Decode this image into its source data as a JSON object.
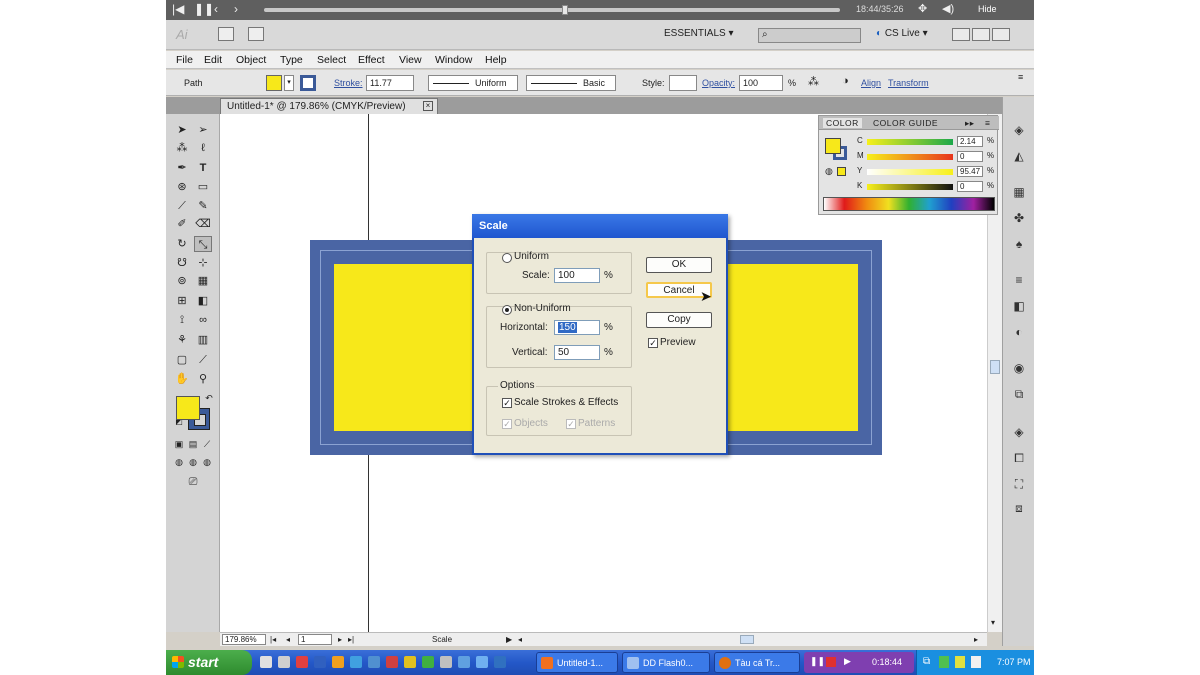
{
  "video_player": {
    "time": "18:44/35:26",
    "hide_label": "Hide"
  },
  "app": {
    "logo": "Ai",
    "workspace": "ESSENTIALS",
    "cs_live": "CS Live"
  },
  "menu": [
    "File",
    "Edit",
    "Object",
    "Type",
    "Select",
    "Effect",
    "View",
    "Window",
    "Help"
  ],
  "control_bar": {
    "selection_label": "Path",
    "stroke_label": "Stroke:",
    "stroke_weight": "11.77",
    "stroke_profile": "Uniform",
    "brush": "Basic",
    "style_label": "Style:",
    "opacity_label": "Opacity:",
    "opacity_value": "100",
    "opacity_unit": "%",
    "align_link": "Align",
    "transform_link": "Transform"
  },
  "document_tab": {
    "title": "Untitled-1* @ 179.86% (CMYK/Preview)",
    "close": "×"
  },
  "status_bar": {
    "zoom": "179.86%",
    "page": "1",
    "info": "Scale"
  },
  "color_panel": {
    "tab_color": "COLOR",
    "tab_guide": "COLOR GUIDE",
    "channels": [
      {
        "label": "C",
        "value": "2.14",
        "unit": "%"
      },
      {
        "label": "M",
        "value": "0",
        "unit": "%"
      },
      {
        "label": "Y",
        "value": "95.47",
        "unit": "%"
      },
      {
        "label": "K",
        "value": "0",
        "unit": "%"
      }
    ]
  },
  "scale_dialog": {
    "title": "Scale",
    "uniform_label": "Uniform",
    "scale_label": "Scale:",
    "scale_value": "100",
    "nonuniform_label": "Non-Uniform",
    "horizontal_label": "Horizontal:",
    "horizontal_value": "150",
    "vertical_label": "Vertical:",
    "vertical_value": "50",
    "percent": "%",
    "options_label": "Options",
    "scale_strokes_label": "Scale Strokes & Effects",
    "objects_label": "Objects",
    "patterns_label": "Patterns",
    "ok_label": "OK",
    "cancel_label": "Cancel",
    "copy_label": "Copy",
    "preview_label": "Preview"
  },
  "taskbar": {
    "start": "start",
    "tasks": [
      "Untitled-1...",
      "DD Flash0...",
      "Tàu cá Tr..."
    ],
    "media_time": "0:18:44",
    "clock": "7:07 PM"
  },
  "colors": {
    "fill": "#f7e81a",
    "stroke": "#4a65a4",
    "dialog_title": "#1f56cf"
  }
}
